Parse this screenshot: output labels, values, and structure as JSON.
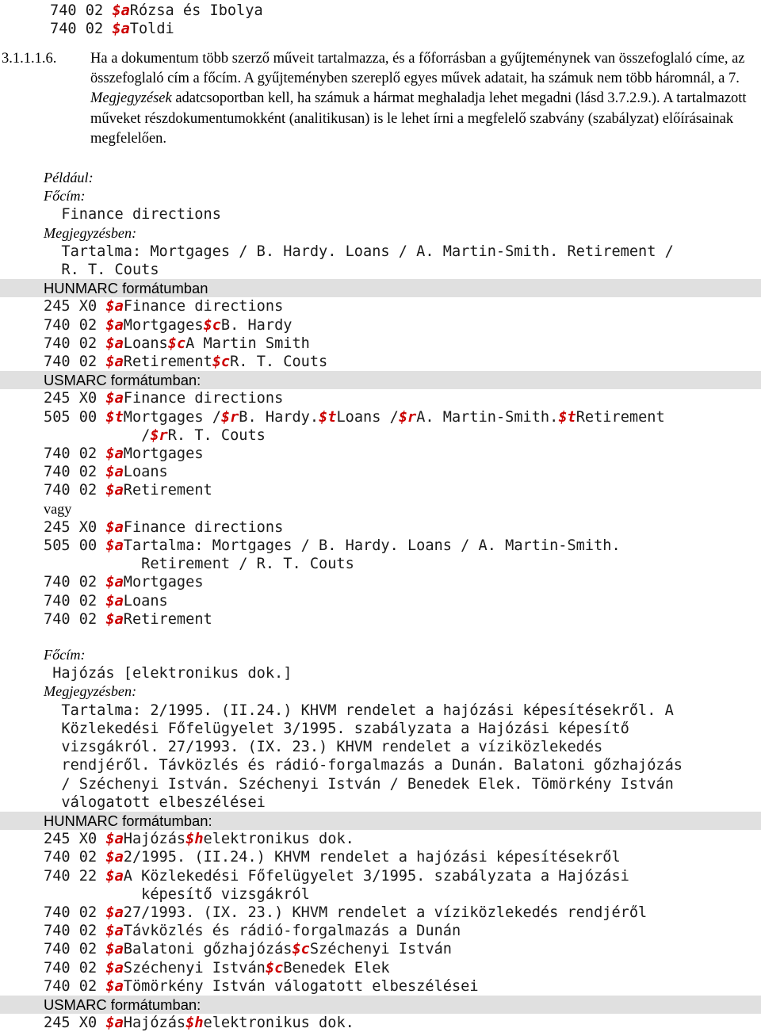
{
  "document": {
    "language": "hu",
    "clause": {
      "number": "3.1.1.1.6.",
      "text_runs": [
        {
          "t": "Ha a dokumentum több szerző műveit tartalmazza, és a főforrásban a gyűjteménynek van összefoglaló címe, az összefoglaló cím a főcím. A gyűjteményben szereplő egyes művek adatait, ha számuk nem több háromnál, a 7. ",
          "i": false
        },
        {
          "t": "Megjegyzések",
          "i": true
        },
        {
          "t": " adatcsoportban kell, ha számuk a hármat meghaladja lehet megadni (lásd 3.7.2.9.). A tartalmazott műveket részdokumentumokként (analitikusan) is le lehet írni a megfelelő szabvány (szabályzat) előírásainak megfelelően.",
          "i": false
        }
      ]
    }
  },
  "top_marc_lines": [
    [
      {
        "t": "740 02 ",
        "red": false
      },
      {
        "t": "$a",
        "red": true
      },
      {
        "t": "Rózsa és Ibolya",
        "red": false
      }
    ],
    [
      {
        "t": "740 02 ",
        "red": false
      },
      {
        "t": "$a",
        "red": true
      },
      {
        "t": "Toldi",
        "red": false
      }
    ]
  ],
  "labels": {
    "peldaul": "Például:",
    "focim": "Főcím:",
    "megjegyzesben": "Megjegyzésben:",
    "vagy": "vagy",
    "hunmarc_1": "HUNMARC formátumban",
    "usmarc_1": "USMARC formátumban:",
    "hunmarc_2": "HUNMARC formátumban:",
    "usmarc_2": "USMARC formátumban:"
  },
  "example_1": {
    "focim_value": "  Finance directions",
    "megjegyzesben_value_lines": [
      "  Tartalma: Mortgages / B. Hardy. Loans / A. Martin-Smith. Retirement /",
      "  R. T. Couts"
    ],
    "hunmarc_lines": [
      [
        {
          "t": "245 X0 ",
          "red": false
        },
        {
          "t": "$a",
          "red": true
        },
        {
          "t": "Finance directions",
          "red": false
        }
      ],
      [
        {
          "t": "740 02 ",
          "red": false
        },
        {
          "t": "$a",
          "red": true
        },
        {
          "t": "Mortgages",
          "red": false
        },
        {
          "t": "$c",
          "red": true
        },
        {
          "t": "B. Hardy",
          "red": false
        }
      ],
      [
        {
          "t": "740 02 ",
          "red": false
        },
        {
          "t": "$a",
          "red": true
        },
        {
          "t": "Loans",
          "red": false
        },
        {
          "t": "$c",
          "red": true
        },
        {
          "t": "A Martin Smith",
          "red": false
        }
      ],
      [
        {
          "t": "740 02 ",
          "red": false
        },
        {
          "t": "$a",
          "red": true
        },
        {
          "t": "Retirement",
          "red": false
        },
        {
          "t": "$c",
          "red": true
        },
        {
          "t": "R. T. Couts",
          "red": false
        }
      ]
    ],
    "usmarc_lines": [
      [
        {
          "t": "245 X0 ",
          "red": false
        },
        {
          "t": "$a",
          "red": true
        },
        {
          "t": "Finance directions",
          "red": false
        }
      ],
      [
        {
          "t": "505 00 ",
          "red": false
        },
        {
          "t": "$t",
          "red": true
        },
        {
          "t": "Mortgages /",
          "red": false
        },
        {
          "t": "$r",
          "red": true
        },
        {
          "t": "B. Hardy.",
          "red": false
        },
        {
          "t": "$t",
          "red": true
        },
        {
          "t": "Loans /",
          "red": false
        },
        {
          "t": "$r",
          "red": true
        },
        {
          "t": "A. Martin-Smith.",
          "red": false
        },
        {
          "t": "$t",
          "red": true
        },
        {
          "t": "Retirement",
          "red": false
        }
      ],
      [
        {
          "t": "           /",
          "red": false
        },
        {
          "t": "$r",
          "red": true
        },
        {
          "t": "R. T. Couts",
          "red": false
        }
      ],
      [
        {
          "t": "740 02 ",
          "red": false
        },
        {
          "t": "$a",
          "red": true
        },
        {
          "t": "Mortgages",
          "red": false
        }
      ],
      [
        {
          "t": "740 02 ",
          "red": false
        },
        {
          "t": "$a",
          "red": true
        },
        {
          "t": "Loans",
          "red": false
        }
      ],
      [
        {
          "t": "740 02 ",
          "red": false
        },
        {
          "t": "$a",
          "red": true
        },
        {
          "t": "Retirement",
          "red": false
        }
      ]
    ],
    "vagy_lines": [
      [
        {
          "t": "245 X0 ",
          "red": false
        },
        {
          "t": "$a",
          "red": true
        },
        {
          "t": "Finance directions",
          "red": false
        }
      ],
      [
        {
          "t": "505 00 ",
          "red": false
        },
        {
          "t": "$a",
          "red": true
        },
        {
          "t": "Tartalma: Mortgages / B. Hardy. Loans / A. Martin-Smith.",
          "red": false
        }
      ],
      [
        {
          "t": "           Retirement / R. T. Couts",
          "red": false
        }
      ],
      [
        {
          "t": "740 02 ",
          "red": false
        },
        {
          "t": "$a",
          "red": true
        },
        {
          "t": "Mortgages",
          "red": false
        }
      ],
      [
        {
          "t": "740 02 ",
          "red": false
        },
        {
          "t": "$a",
          "red": true
        },
        {
          "t": "Loans",
          "red": false
        }
      ],
      [
        {
          "t": "740 02 ",
          "red": false
        },
        {
          "t": "$a",
          "red": true
        },
        {
          "t": "Retirement",
          "red": false
        }
      ]
    ]
  },
  "example_2": {
    "focim_value": " Hajózás [elektronikus dok.]",
    "megjegyzesben_value_lines": [
      "  Tartalma: 2/1995. (II.24.) KHVM rendelet a hajózási képesítésekről. A",
      "  Közlekedési Főfelügyelet 3/1995. szabályzata a Hajózási képesítő",
      "  vizsgákról. 27/1993. (IX. 23.) KHVM rendelet a víziközlekedés",
      "  rendjéről. Távközlés és rádió-forgalmazás a Dunán. Balatoni gőzhajózás",
      "  / Széchenyi István. Széchenyi István / Benedek Elek. Tömörkény István",
      "  válogatott elbeszélései"
    ],
    "hunmarc_lines": [
      [
        {
          "t": "245 X0 ",
          "red": false
        },
        {
          "t": "$a",
          "red": true
        },
        {
          "t": "Hajózás",
          "red": false
        },
        {
          "t": "$h",
          "red": true
        },
        {
          "t": "elektronikus dok.",
          "red": false
        }
      ],
      [
        {
          "t": "740 02 ",
          "red": false
        },
        {
          "t": "$a",
          "red": true
        },
        {
          "t": "2/1995. (II.24.) KHVM rendelet a hajózási képesítésekről",
          "red": false
        }
      ],
      [
        {
          "t": "740 22 ",
          "red": false
        },
        {
          "t": "$a",
          "red": true
        },
        {
          "t": "A Közlekedési Főfelügyelet 3/1995. szabályzata a Hajózási",
          "red": false
        }
      ],
      [
        {
          "t": "           képesítő vizsgákról",
          "red": false
        }
      ],
      [
        {
          "t": "740 02 ",
          "red": false
        },
        {
          "t": "$a",
          "red": true
        },
        {
          "t": "27/1993. (IX. 23.) KHVM rendelet a víziközlekedés rendjéről",
          "red": false
        }
      ],
      [
        {
          "t": "740 02 ",
          "red": false
        },
        {
          "t": "$a",
          "red": true
        },
        {
          "t": "Távközlés és rádió-forgalmazás a Dunán",
          "red": false
        }
      ],
      [
        {
          "t": "740 02 ",
          "red": false
        },
        {
          "t": "$a",
          "red": true
        },
        {
          "t": "Balatoni gőzhajózás",
          "red": false
        },
        {
          "t": "$c",
          "red": true
        },
        {
          "t": "Széchenyi István",
          "red": false
        }
      ],
      [
        {
          "t": "740 02 ",
          "red": false
        },
        {
          "t": "$a",
          "red": true
        },
        {
          "t": "Széchenyi István",
          "red": false
        },
        {
          "t": "$c",
          "red": true
        },
        {
          "t": "Benedek Elek",
          "red": false
        }
      ],
      [
        {
          "t": "740 02 ",
          "red": false
        },
        {
          "t": "$a",
          "red": true
        },
        {
          "t": "Tömörkény István válogatott elbeszélései",
          "red": false
        }
      ]
    ],
    "usmarc_lines": [
      [
        {
          "t": "245 X0 ",
          "red": false
        },
        {
          "t": "$a",
          "red": true
        },
        {
          "t": "Hajózás",
          "red": false
        },
        {
          "t": "$h",
          "red": true
        },
        {
          "t": "elektronikus dok.",
          "red": false
        }
      ]
    ]
  },
  "colors": {
    "subfield_red": "#cc0000",
    "band_gray": "#e0e0e0",
    "text": "#1a1a1a"
  }
}
